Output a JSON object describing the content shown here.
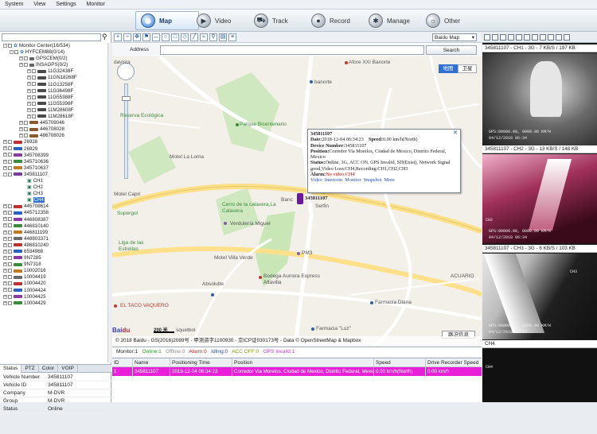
{
  "menu": {
    "items": [
      "System",
      "View",
      "Settings",
      "Monitor"
    ]
  },
  "toolbar": {
    "tabs": [
      {
        "label": "Map",
        "icon": "map-icon",
        "active": true
      },
      {
        "label": "Video",
        "icon": "video-icon",
        "active": false
      },
      {
        "label": "Track",
        "icon": "track-icon",
        "active": false
      },
      {
        "label": "Record",
        "icon": "record-icon",
        "active": false
      },
      {
        "label": "Manage",
        "icon": "manage-icon",
        "active": false
      },
      {
        "label": "Other",
        "icon": "other-icon",
        "active": false
      }
    ]
  },
  "tree": {
    "root": "Monitor Center(16/534)",
    "group": "HYFCEM88(0/14)",
    "sub1": "GPSCEM(0/2)",
    "sub2": "INSAGPS(0/2)",
    "devices_a": [
      "11G32438F",
      "11GN18268F",
      "11G13258F",
      "11G36498F",
      "11G55388F",
      "11G55398F",
      "11M28608F",
      "11M28618F"
    ],
    "devices_b": [
      "445709046",
      "446708028",
      "486708026"
    ],
    "devices_c": [
      "26928",
      "26929",
      "345708399",
      "345710636",
      "345710637"
    ],
    "selected_vehicle": "345811107",
    "channels": [
      "CH1",
      "CH2",
      "CH3",
      "CH4"
    ],
    "devices_d": [
      "445708614",
      "445712358",
      "446808387",
      "446810140",
      "446811199",
      "448803371",
      "486810240",
      "6534968",
      "9N7285",
      "9N7318",
      "10002016",
      "10004419",
      "10004420",
      "10004424",
      "10004425",
      "10004429"
    ]
  },
  "left_tabs": [
    "Status",
    "PTZ",
    "Color",
    "VOIP"
  ],
  "vehicle_info": [
    {
      "k": "Vehicle Number",
      "v": "345811107"
    },
    {
      "k": "Vehicle ID",
      "v": "345811107"
    },
    {
      "k": "Company",
      "v": "M-DVR"
    },
    {
      "k": "Group",
      "v": "M-DVR"
    },
    {
      "k": "Status",
      "v": "Online"
    }
  ],
  "map": {
    "provider": "Baidu Map",
    "address_label": "Address",
    "search_label": "Search",
    "map_toggle": "地图",
    "sat_toggle": "卫星",
    "labels": {
      "l1": "davista",
      "l2": "Afore XXI Banorte",
      "l3": "banorte",
      "l4": "Reserva Ecológica",
      "l5": "Parque Bicentenario",
      "l6": "Motel La Loma",
      "l7": "Motel Capri",
      "l8": "Supergol",
      "l9": "Cerro de la calavera,La Calavera",
      "l10": "Verdulería Miguel",
      "l11": "Liga de las Estrellas",
      "l12": "Motel Villa Verde",
      "l13": "PM3",
      "l14": "Bodega Aurrera Express Altavilla",
      "l15": "Absolutte",
      "l16": "EL TACO VAQUERO",
      "l17": "Farmacia Diana",
      "l18": "Farmacia \"Luz\"",
      "l19": "ACUARIO",
      "l20": "Banc",
      "l21": "Serfin",
      "l22": "squetbol"
    },
    "traffic_info": "路况信息",
    "scale": "200 米",
    "footer": "© 2018 Baidu - GS(2016)2089号 - 甲测资字1100930 - 京ICP证030173号 - Data © OpenStreetMap & Mapbox"
  },
  "popup": {
    "vehicle": "345811107",
    "date_label": "Date:",
    "date": "2018-12-04 06:34:23",
    "speed_label": "Speed:",
    "speed": "0.00 km/h(North)",
    "devnum_label": "Device Number:",
    "devnum": "345811107",
    "position_label": "Position:",
    "position": "Corredor Via Morelos, Ciudad de Mexico, Distrito Federal, Mexico",
    "status_label": "Status:",
    "status": "Online, 3G, ACC ON, GPS Invalid, SD(Exist), Network Signal good,Video Loss:CH4,Recording:CH1,CH2,CH3",
    "alarm_label": "Alarm:",
    "alarm": "No video:CH4",
    "links": [
      "Video",
      "Intercom",
      "Monitor",
      "Snapshot",
      "More"
    ]
  },
  "status_counts": {
    "monitor": "Monitor:1",
    "online": "Online:1",
    "offline": "Offline:0",
    "alarm": "Alarm:0",
    "idling": "Idling:0",
    "accoff": "ACC OFF:0",
    "gpsinvalid": "GPS Invalid:1"
  },
  "grid": {
    "columns": [
      "ID",
      "Name",
      "Positioning Time",
      "Position",
      "Speed",
      "Drive Recorder Speed"
    ],
    "row": [
      "1",
      "345811107",
      "2018-12-04 06:34:23",
      "Corredor Via Morelos, Ciudad de Mexico, Distrito Federal, Mexico",
      "0.00 km/h(North)",
      "0.00 km/h"
    ]
  },
  "video": {
    "ch1_caption": "345811107 - CH1 - 3G - 7 KB/S / 197 KB",
    "ch2_caption": "345811107 - CH2 - 3G - 13 KB/S / 148 KB",
    "ch3_caption": "345811107 - CH3 - 3G - 6 KB/S / 103 KB",
    "ch4_caption": "CH4",
    "ch1_osd": "GPS:00000.00, 0000.00 KM/H",
    "ch1_date": "04/12/2018  06:34",
    "ch2_osd": "GPS:00000.00, 0000.00 KM/H",
    "ch2_date": "04/12/2018  06:34",
    "ch3_osd": "GPS:00000.00, 0000.00 KM/H",
    "ch3_date": "04/12/2018  06:34",
    "ch2_label": "CH2",
    "ch3_label": "CH3"
  },
  "colors": {
    "accent": "#2f6fd0",
    "selected_row": "#e820d8",
    "marker": "#6a1a9a"
  }
}
